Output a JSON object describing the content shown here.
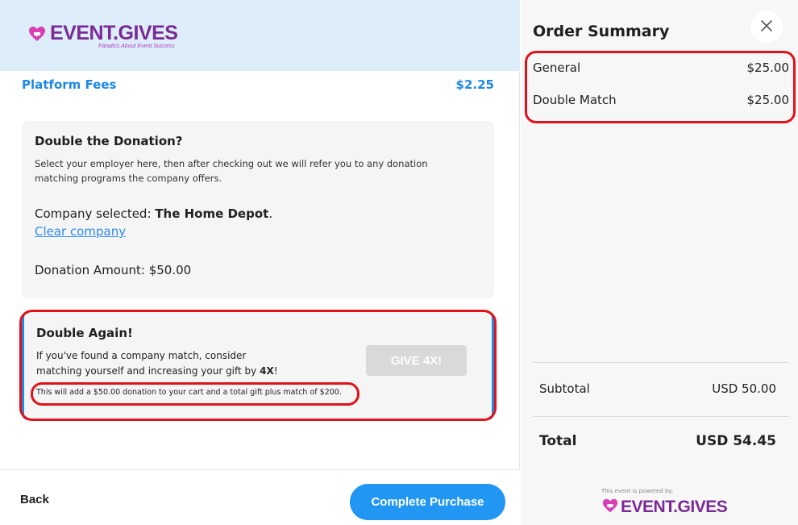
{
  "brand": {
    "name": "EVENT.GIVES",
    "tagline": "Fanatics About Event Success",
    "primary_color": "#7a2a96",
    "accent_color": "#e54fb8"
  },
  "fees": {
    "label": "Platform Fees",
    "amount": "$2.25"
  },
  "double_donation": {
    "title": "Double the Donation?",
    "description": "Select your employer here, then after checking out we will refer you to any donation matching programs the company offers.",
    "company_prefix": "Company selected: ",
    "company_name": "The Home Depot",
    "company_suffix": ".",
    "clear_label": "Clear company",
    "donation_label": "Donation Amount: $50.00"
  },
  "double_again": {
    "title": "Double Again!",
    "desc_prefix": "If you've found a company match, consider matching yourself and increasing your gift by ",
    "multiplier": "4X",
    "desc_suffix": "!",
    "note": "This will add a $50.00 donation to your cart and a total gift plus match of $200.",
    "button_label": "GIVE 4X!"
  },
  "footer": {
    "back_label": "Back",
    "purchase_label": "Complete Purchase"
  },
  "summary": {
    "title": "Order Summary",
    "items": [
      {
        "name": "General",
        "price": "$25.00"
      },
      {
        "name": "Double Match",
        "price": "$25.00"
      }
    ],
    "subtotal_label": "Subtotal",
    "subtotal_value": "USD 50.00",
    "total_label": "Total",
    "total_value": "USD 54.45",
    "powered_by": "This event is powered by:"
  },
  "icons": {
    "close": "close-icon",
    "heart": "heart-logo-icon"
  },
  "colors": {
    "highlight_red": "#e0121b",
    "link_blue": "#1e88e5",
    "button_blue": "#2196f3",
    "header_bg": "#ddeefa"
  }
}
